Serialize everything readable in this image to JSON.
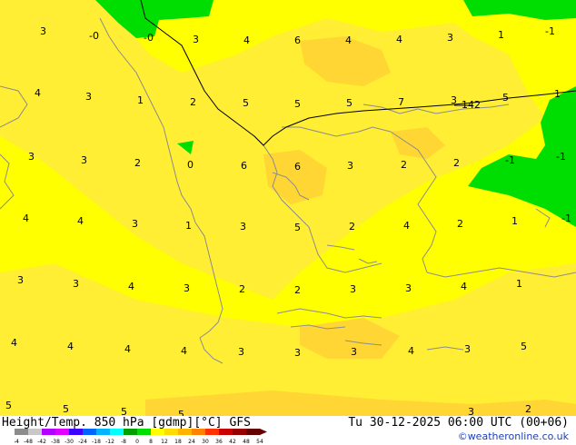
{
  "map": {
    "field_colors": {
      "yellow": "#ffff00",
      "yellow_light": "#ffee33",
      "orange": "#ffd633",
      "green": "#00dd00",
      "coast": "#8c8c8c",
      "border": "#000000"
    },
    "contour_label": "142",
    "temperature_labels": [
      "3",
      "-0",
      "-0",
      "3",
      "4",
      "6",
      "4",
      "4",
      "3",
      "1",
      "-1",
      "4",
      "3",
      "1",
      "2",
      "5",
      "5",
      "5",
      "7",
      "3",
      "5",
      "1",
      "3",
      "3",
      "2",
      "0",
      "6",
      "6",
      "3",
      "2",
      "2",
      "-1",
      "-1",
      "4",
      "4",
      "3",
      "1",
      "3",
      "5",
      "2",
      "4",
      "2",
      "1",
      "-1",
      "3",
      "3",
      "4",
      "3",
      "2",
      "2",
      "3",
      "3",
      "4",
      "1",
      "4",
      "4",
      "4",
      "4",
      "3",
      "3",
      "3",
      "4",
      "3",
      "5",
      "5",
      "5",
      "5",
      "5",
      "3",
      "2"
    ]
  },
  "footer": {
    "title": "Height/Temp. 850 hPa [gdmp][°C] GFS",
    "valid_time": "Tu 30-12-2025 06:00 UTC (00+06)",
    "credit": "©weatheronline.co.uk",
    "scale_ticks": [
      "-54",
      "-48",
      "-42",
      "-38",
      "-30",
      "-24",
      "-18",
      "-12",
      "-8",
      "0",
      "8",
      "12",
      "18",
      "24",
      "30",
      "36",
      "42",
      "48",
      "54"
    ],
    "scale_colors": [
      "#8c8c8c",
      "#c8c8c8",
      "#b400ff",
      "#e100ff",
      "#3c00ff",
      "#0064ff",
      "#00b4ff",
      "#00ffff",
      "#00a000",
      "#00dd00",
      "#ffff00",
      "#ffdc00",
      "#ffb400",
      "#ff8200",
      "#ff3200",
      "#c80000",
      "#960000",
      "#640000"
    ]
  }
}
